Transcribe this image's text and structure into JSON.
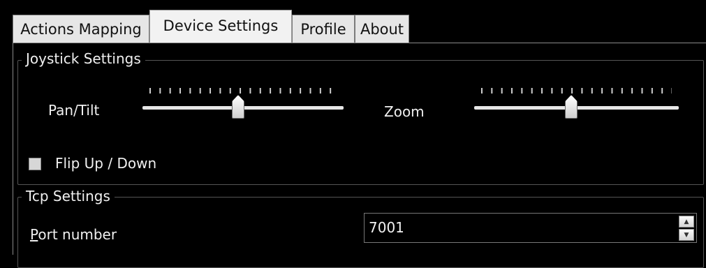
{
  "tabs": [
    {
      "label": "Actions Mapping"
    },
    {
      "label": "Device Settings"
    },
    {
      "label": "Profile"
    },
    {
      "label": "About"
    }
  ],
  "joystick": {
    "title": "Joystick Settings",
    "pan_tilt_label": "Pan/Tilt",
    "pan_tilt_value": 0.47,
    "zoom_label": "Zoom",
    "zoom_value": 0.47,
    "flip_label": "Flip Up / Down",
    "flip_checked": false
  },
  "tcp": {
    "title": "Tcp Settings",
    "port_label_mnemonic": "P",
    "port_label_rest": "ort number",
    "port_value": "7001"
  },
  "colors": {
    "background": "#000000",
    "tab_active": "#f2f2f2",
    "tab_inactive": "#e6e6e6",
    "text": "#f0f0f0"
  },
  "icons": {
    "spin_up": "triangle-up",
    "spin_down": "triangle-down"
  }
}
